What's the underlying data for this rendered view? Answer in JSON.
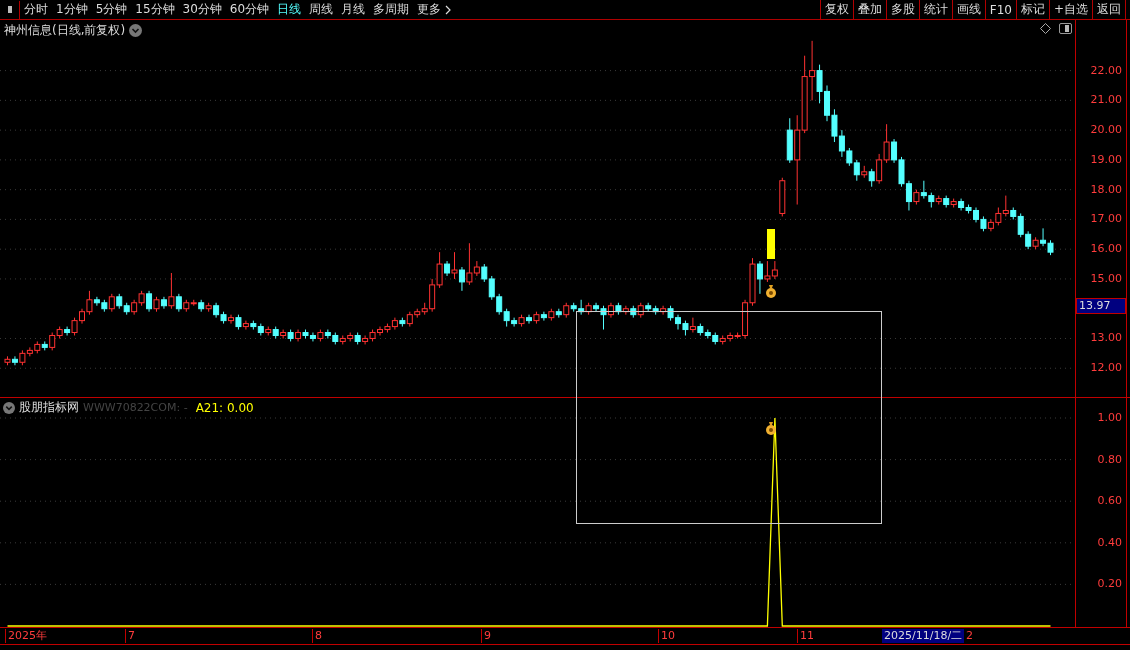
{
  "toolbar": {
    "periods": [
      {
        "label": "分时",
        "selected": false
      },
      {
        "label": "1分钟",
        "selected": false
      },
      {
        "label": "5分钟",
        "selected": false
      },
      {
        "label": "15分钟",
        "selected": false
      },
      {
        "label": "30分钟",
        "selected": false
      },
      {
        "label": "60分钟",
        "selected": false
      },
      {
        "label": "日线",
        "selected": true
      },
      {
        "label": "周线",
        "selected": false
      },
      {
        "label": "月线",
        "selected": false
      },
      {
        "label": "多周期",
        "selected": false
      },
      {
        "label": "更多",
        "selected": false
      }
    ],
    "actions": [
      "复权",
      "叠加",
      "多股",
      "统计",
      "画线",
      "F10",
      "标记",
      "+自选",
      "返回"
    ]
  },
  "main_chart": {
    "title": "神州信息(日线,前复权)",
    "last_price": "13.97",
    "chart_data": {
      "type": "candlestick",
      "grid": true,
      "ylim": [
        11,
        23.7
      ],
      "yticks": [
        {
          "value": 22,
          "label": "22.00"
        },
        {
          "value": 21,
          "label": "21.00"
        },
        {
          "value": 20,
          "label": "20.00"
        },
        {
          "value": 19,
          "label": "19.00"
        },
        {
          "value": 18,
          "label": "18.00"
        },
        {
          "value": 17,
          "label": "17.00"
        },
        {
          "value": 16,
          "label": "16.00"
        },
        {
          "value": 15,
          "label": "15.00"
        },
        {
          "value": 13,
          "label": "13.00"
        },
        {
          "value": 12,
          "label": "12.00"
        }
      ],
      "ohlc": [
        [
          12.2,
          12.4,
          12.1,
          12.3
        ],
        [
          12.3,
          12.4,
          12.1,
          12.2
        ],
        [
          12.2,
          12.6,
          12.1,
          12.5
        ],
        [
          12.5,
          12.7,
          12.4,
          12.6
        ],
        [
          12.6,
          12.9,
          12.5,
          12.8
        ],
        [
          12.8,
          12.9,
          12.6,
          12.7
        ],
        [
          12.7,
          13.2,
          12.6,
          13.1
        ],
        [
          13.1,
          13.4,
          13.0,
          13.3
        ],
        [
          13.3,
          13.4,
          13.1,
          13.2
        ],
        [
          13.2,
          13.7,
          13.1,
          13.6
        ],
        [
          13.6,
          14.0,
          13.5,
          13.9
        ],
        [
          13.9,
          14.6,
          13.8,
          14.3
        ],
        [
          14.3,
          14.4,
          14.1,
          14.2
        ],
        [
          14.2,
          14.3,
          13.9,
          14.0
        ],
        [
          14.0,
          14.5,
          13.9,
          14.4
        ],
        [
          14.4,
          14.5,
          14.0,
          14.1
        ],
        [
          14.1,
          14.2,
          13.8,
          13.9
        ],
        [
          13.9,
          14.3,
          13.8,
          14.2
        ],
        [
          14.2,
          14.6,
          14.1,
          14.5
        ],
        [
          14.5,
          14.6,
          13.9,
          14.0
        ],
        [
          14.0,
          14.4,
          13.9,
          14.3
        ],
        [
          14.3,
          14.4,
          14.0,
          14.1
        ],
        [
          14.1,
          15.2,
          14.0,
          14.4
        ],
        [
          14.4,
          14.5,
          13.9,
          14.0
        ],
        [
          14.0,
          14.3,
          13.9,
          14.2
        ],
        [
          14.2,
          14.3,
          14.1,
          14.2
        ],
        [
          14.2,
          14.3,
          13.9,
          14.0
        ],
        [
          14.0,
          14.2,
          13.9,
          14.1
        ],
        [
          14.1,
          14.2,
          13.7,
          13.8
        ],
        [
          13.8,
          13.9,
          13.5,
          13.6
        ],
        [
          13.6,
          13.8,
          13.5,
          13.7
        ],
        [
          13.7,
          13.8,
          13.3,
          13.4
        ],
        [
          13.4,
          13.6,
          13.3,
          13.5
        ],
        [
          13.5,
          13.6,
          13.3,
          13.4
        ],
        [
          13.4,
          13.5,
          13.1,
          13.2
        ],
        [
          13.2,
          13.4,
          13.1,
          13.3
        ],
        [
          13.3,
          13.4,
          13.0,
          13.1
        ],
        [
          13.1,
          13.3,
          13.0,
          13.2
        ],
        [
          13.2,
          13.3,
          12.9,
          13.0
        ],
        [
          13.0,
          13.3,
          12.9,
          13.2
        ],
        [
          13.2,
          13.3,
          13.0,
          13.1
        ],
        [
          13.1,
          13.2,
          12.9,
          13.0
        ],
        [
          13.0,
          13.3,
          12.9,
          13.2
        ],
        [
          13.2,
          13.3,
          13.0,
          13.1
        ],
        [
          13.1,
          13.2,
          12.8,
          12.9
        ],
        [
          12.9,
          13.1,
          12.8,
          13.0
        ],
        [
          13.0,
          13.2,
          12.9,
          13.1
        ],
        [
          13.1,
          13.2,
          12.8,
          12.9
        ],
        [
          12.9,
          13.1,
          12.8,
          13.0
        ],
        [
          13.0,
          13.3,
          12.9,
          13.2
        ],
        [
          13.2,
          13.4,
          13.1,
          13.3
        ],
        [
          13.3,
          13.5,
          13.2,
          13.4
        ],
        [
          13.4,
          13.7,
          13.3,
          13.6
        ],
        [
          13.6,
          13.7,
          13.4,
          13.5
        ],
        [
          13.5,
          13.9,
          13.4,
          13.8
        ],
        [
          13.8,
          14.0,
          13.7,
          13.9
        ],
        [
          13.9,
          14.2,
          13.8,
          14.0
        ],
        [
          14.0,
          15.0,
          13.9,
          14.8
        ],
        [
          14.8,
          15.9,
          14.7,
          15.5
        ],
        [
          15.5,
          15.6,
          15.1,
          15.2
        ],
        [
          15.2,
          15.9,
          15.0,
          15.3
        ],
        [
          15.3,
          15.4,
          14.6,
          14.9
        ],
        [
          14.9,
          16.2,
          14.8,
          15.2
        ],
        [
          15.2,
          15.6,
          15.1,
          15.4
        ],
        [
          15.4,
          15.5,
          14.9,
          15.0
        ],
        [
          15.0,
          15.1,
          14.3,
          14.4
        ],
        [
          14.4,
          14.5,
          13.8,
          13.9
        ],
        [
          13.9,
          14.0,
          13.4,
          13.6
        ],
        [
          13.6,
          13.7,
          13.4,
          13.5
        ],
        [
          13.5,
          13.8,
          13.4,
          13.7
        ],
        [
          13.7,
          13.8,
          13.5,
          13.6
        ],
        [
          13.6,
          13.9,
          13.5,
          13.8
        ],
        [
          13.8,
          13.9,
          13.6,
          13.7
        ],
        [
          13.7,
          14.0,
          13.6,
          13.9
        ],
        [
          13.9,
          14.0,
          13.7,
          13.8
        ],
        [
          13.8,
          14.2,
          13.7,
          14.1
        ],
        [
          14.1,
          14.2,
          13.9,
          14.0
        ],
        [
          14.0,
          14.3,
          13.8,
          13.9
        ],
        [
          13.9,
          14.2,
          13.8,
          14.1
        ],
        [
          14.1,
          14.2,
          13.9,
          14.0
        ],
        [
          14.0,
          14.1,
          13.3,
          13.8
        ],
        [
          13.8,
          14.2,
          13.7,
          14.1
        ],
        [
          14.1,
          14.2,
          13.8,
          13.9
        ],
        [
          13.9,
          14.1,
          13.8,
          14.0
        ],
        [
          14.0,
          14.1,
          13.7,
          13.8
        ],
        [
          13.8,
          14.2,
          13.7,
          14.1
        ],
        [
          14.1,
          14.2,
          13.9,
          14.0
        ],
        [
          14.0,
          14.1,
          13.8,
          13.9
        ],
        [
          13.9,
          14.1,
          13.8,
          14.0
        ],
        [
          14.0,
          14.1,
          13.6,
          13.7
        ],
        [
          13.7,
          13.8,
          13.3,
          13.5
        ],
        [
          13.5,
          13.6,
          13.1,
          13.3
        ],
        [
          13.3,
          13.7,
          13.2,
          13.4
        ],
        [
          13.4,
          13.5,
          13.1,
          13.2
        ],
        [
          13.2,
          13.3,
          13.0,
          13.1
        ],
        [
          13.1,
          13.2,
          12.8,
          12.9
        ],
        [
          12.9,
          13.1,
          12.8,
          13.0
        ],
        [
          13.0,
          13.2,
          12.9,
          13.1
        ],
        [
          13.1,
          13.2,
          13.0,
          13.1
        ],
        [
          13.1,
          14.3,
          13.0,
          14.2
        ],
        [
          14.2,
          15.7,
          14.1,
          15.5
        ],
        [
          15.5,
          15.6,
          14.5,
          15.0
        ],
        [
          15.0,
          15.6,
          14.9,
          15.1
        ],
        [
          15.1,
          15.6,
          15.0,
          15.3
        ],
        [
          17.2,
          18.4,
          17.1,
          18.3
        ],
        [
          20.0,
          20.4,
          18.9,
          19.0
        ],
        [
          19.0,
          20.5,
          17.5,
          20.0
        ],
        [
          20.0,
          22.5,
          19.9,
          21.8
        ],
        [
          21.8,
          23.0,
          21.0,
          22.0
        ],
        [
          22.0,
          22.2,
          20.9,
          21.3
        ],
        [
          21.3,
          21.5,
          20.3,
          20.5
        ],
        [
          20.5,
          20.7,
          19.6,
          19.8
        ],
        [
          19.8,
          20.0,
          19.1,
          19.3
        ],
        [
          19.3,
          19.4,
          18.8,
          18.9
        ],
        [
          18.9,
          19.0,
          18.3,
          18.5
        ],
        [
          18.5,
          18.8,
          18.4,
          18.6
        ],
        [
          18.6,
          18.7,
          18.1,
          18.3
        ],
        [
          18.3,
          19.2,
          18.2,
          19.0
        ],
        [
          19.0,
          20.2,
          18.9,
          19.6
        ],
        [
          19.6,
          19.7,
          18.9,
          19.0
        ],
        [
          19.0,
          19.1,
          18.1,
          18.2
        ],
        [
          18.2,
          18.3,
          17.3,
          17.6
        ],
        [
          17.6,
          18.0,
          17.5,
          17.9
        ],
        [
          17.9,
          18.3,
          17.7,
          17.8
        ],
        [
          17.8,
          17.9,
          17.4,
          17.6
        ],
        [
          17.6,
          17.8,
          17.5,
          17.7
        ],
        [
          17.7,
          17.8,
          17.4,
          17.5
        ],
        [
          17.5,
          17.7,
          17.4,
          17.6
        ],
        [
          17.6,
          17.7,
          17.3,
          17.4
        ],
        [
          17.4,
          17.5,
          17.2,
          17.3
        ],
        [
          17.3,
          17.4,
          16.9,
          17.0
        ],
        [
          17.0,
          17.1,
          16.6,
          16.7
        ],
        [
          16.7,
          17.0,
          16.6,
          16.9
        ],
        [
          16.9,
          17.4,
          16.8,
          17.2
        ],
        [
          17.2,
          17.8,
          17.1,
          17.3
        ],
        [
          17.3,
          17.4,
          17.0,
          17.1
        ],
        [
          17.1,
          17.2,
          16.4,
          16.5
        ],
        [
          16.5,
          16.6,
          16.0,
          16.1
        ],
        [
          16.1,
          16.4,
          16.0,
          16.3
        ],
        [
          16.3,
          16.7,
          16.1,
          16.2
        ],
        [
          16.2,
          16.3,
          15.8,
          15.9
        ]
      ]
    }
  },
  "indicator": {
    "name": "股朋指标网",
    "source": "WWW70822COM: -",
    "reading": ": 0.00",
    "chart_data": {
      "type": "line",
      "grid": true,
      "ylim": [
        0,
        1
      ],
      "yticks": [
        {
          "value": 0.2,
          "label": "0.20"
        },
        {
          "value": 0.4,
          "label": "0.40"
        },
        {
          "value": 0.6,
          "label": "0.60"
        },
        {
          "value": 0.8,
          "label": "0.80"
        },
        {
          "value": 1.0,
          "label": "1.00"
        }
      ],
      "series": [
        {
          "name": "A21",
          "color": "#ffff00",
          "values": [
            0,
            0,
            0,
            0,
            0,
            0,
            0,
            0,
            0,
            0,
            0,
            0,
            0,
            0,
            0,
            0,
            0,
            0,
            0,
            0,
            0,
            0,
            0,
            0,
            0,
            0,
            0,
            0,
            0,
            0,
            0,
            0,
            0,
            0,
            0,
            0,
            0,
            0,
            0,
            0,
            0,
            0,
            0,
            0,
            0,
            0,
            0,
            0,
            0,
            0,
            0,
            0,
            0,
            0,
            0,
            0,
            0,
            0,
            0,
            0,
            0,
            0,
            0,
            0,
            0,
            0,
            0,
            0,
            0,
            0,
            0,
            0,
            0,
            0,
            0,
            0,
            0,
            0,
            0,
            0,
            0,
            0,
            0,
            0,
            0,
            0,
            0,
            0,
            0,
            0,
            0,
            0,
            0,
            0,
            0,
            0,
            0,
            0,
            0,
            0,
            0,
            0,
            0,
            1,
            0,
            0,
            0,
            0,
            0,
            0,
            0,
            0,
            0,
            0,
            0,
            0,
            0,
            0,
            0,
            0,
            0,
            0,
            0,
            0,
            0,
            0,
            0,
            0,
            0,
            0,
            0,
            0,
            0,
            0,
            0,
            0,
            0,
            0,
            0,
            0,
            0
          ]
        }
      ]
    }
  },
  "time_axis": {
    "labels": [
      "2025年",
      "7",
      "8",
      "9",
      "10",
      "11"
    ],
    "cursor_date": "2025/11/18/二",
    "cursor_next": "2"
  }
}
